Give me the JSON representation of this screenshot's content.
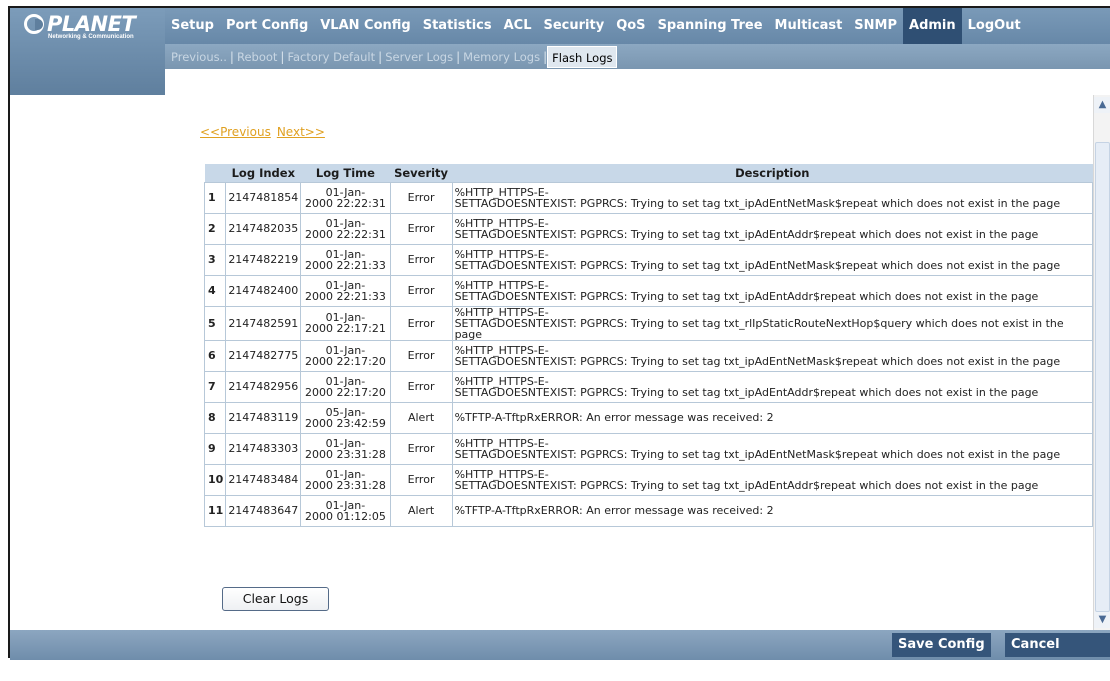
{
  "brand": {
    "name": "PLANET",
    "tagline": "Networking & Communication"
  },
  "nav": [
    {
      "label": "Setup"
    },
    {
      "label": "Port Config"
    },
    {
      "label": "VLAN Config"
    },
    {
      "label": "Statistics"
    },
    {
      "label": "ACL"
    },
    {
      "label": "Security"
    },
    {
      "label": "QoS"
    },
    {
      "label": "Spanning Tree"
    },
    {
      "label": "Multicast"
    },
    {
      "label": "SNMP"
    },
    {
      "label": "Admin",
      "active": true
    },
    {
      "label": "LogOut"
    }
  ],
  "subnav": [
    {
      "label": "Previous.."
    },
    {
      "label": "Reboot"
    },
    {
      "label": "Factory Default"
    },
    {
      "label": "Server Logs"
    },
    {
      "label": "Memory Logs"
    },
    {
      "label": "Flash Logs",
      "active": true
    }
  ],
  "pager": {
    "previous": "<<Previous",
    "next": "Next>>"
  },
  "table": {
    "headers": [
      "",
      "Log Index",
      "Log Time",
      "Severity",
      "Description"
    ],
    "rows": [
      {
        "n": "1",
        "index": "2147481854",
        "date": "01-Jan-",
        "time": "2000 22:22:31",
        "severity": "Error",
        "desc1": "%HTTP_HTTPS-E-",
        "desc2": "SETTAGDOESNTEXIST: PGPRCS: Trying to set tag txt_ipAdEntNetMask$repeat which does not exist in the page"
      },
      {
        "n": "2",
        "index": "2147482035",
        "date": "01-Jan-",
        "time": "2000 22:22:31",
        "severity": "Error",
        "desc1": "%HTTP_HTTPS-E-",
        "desc2": "SETTAGDOESNTEXIST: PGPRCS: Trying to set tag txt_ipAdEntAddr$repeat which does not exist in the page"
      },
      {
        "n": "3",
        "index": "2147482219",
        "date": "01-Jan-",
        "time": "2000 22:21:33",
        "severity": "Error",
        "desc1": "%HTTP_HTTPS-E-",
        "desc2": "SETTAGDOESNTEXIST: PGPRCS: Trying to set tag txt_ipAdEntNetMask$repeat which does not exist in the page"
      },
      {
        "n": "4",
        "index": "2147482400",
        "date": "01-Jan-",
        "time": "2000 22:21:33",
        "severity": "Error",
        "desc1": "%HTTP_HTTPS-E-",
        "desc2": "SETTAGDOESNTEXIST: PGPRCS: Trying to set tag txt_ipAdEntAddr$repeat which does not exist in the page"
      },
      {
        "n": "5",
        "index": "2147482591",
        "date": "01-Jan-",
        "time": "2000 22:17:21",
        "severity": "Error",
        "desc1": "%HTTP_HTTPS-E-",
        "desc2": "SETTAGDOESNTEXIST: PGPRCS: Trying to set tag txt_rlIpStaticRouteNextHop$query which does not exist in the page"
      },
      {
        "n": "6",
        "index": "2147482775",
        "date": "01-Jan-",
        "time": "2000 22:17:20",
        "severity": "Error",
        "desc1": "%HTTP_HTTPS-E-",
        "desc2": "SETTAGDOESNTEXIST: PGPRCS: Trying to set tag txt_ipAdEntNetMask$repeat which does not exist in the page"
      },
      {
        "n": "7",
        "index": "2147482956",
        "date": "01-Jan-",
        "time": "2000 22:17:20",
        "severity": "Error",
        "desc1": "%HTTP_HTTPS-E-",
        "desc2": "SETTAGDOESNTEXIST: PGPRCS: Trying to set tag txt_ipAdEntAddr$repeat which does not exist in the page"
      },
      {
        "n": "8",
        "index": "2147483119",
        "date": "05-Jan-",
        "time": "2000 23:42:59",
        "severity": "Alert",
        "desc1": "%TFTP-A-TftpRxERROR: An error message was received: 2",
        "desc2": ""
      },
      {
        "n": "9",
        "index": "2147483303",
        "date": "01-Jan-",
        "time": "2000 23:31:28",
        "severity": "Error",
        "desc1": "%HTTP_HTTPS-E-",
        "desc2": "SETTAGDOESNTEXIST: PGPRCS: Trying to set tag txt_ipAdEntNetMask$repeat which does not exist in the page"
      },
      {
        "n": "10",
        "index": "2147483484",
        "date": "01-Jan-",
        "time": "2000 23:31:28",
        "severity": "Error",
        "desc1": "%HTTP_HTTPS-E-",
        "desc2": "SETTAGDOESNTEXIST: PGPRCS: Trying to set tag txt_ipAdEntAddr$repeat which does not exist in the page"
      },
      {
        "n": "11",
        "index": "2147483647",
        "date": "01-Jan-",
        "time": "2000 01:12:05",
        "severity": "Alert",
        "desc1": "%TFTP-A-TftpRxERROR: An error message was received: 2",
        "desc2": ""
      }
    ]
  },
  "buttons": {
    "clear_logs": "Clear Logs",
    "save_config": "Save Config",
    "cancel_config": "Cancel Config"
  },
  "scrollbar": {
    "up_icon": "chevron-up-icon",
    "down_icon": "chevron-down-icon"
  },
  "colors": {
    "header": "#6f8fae",
    "active_tab": "#2f4f73",
    "link": "#e0a020",
    "table_header": "#c8d8e8"
  }
}
